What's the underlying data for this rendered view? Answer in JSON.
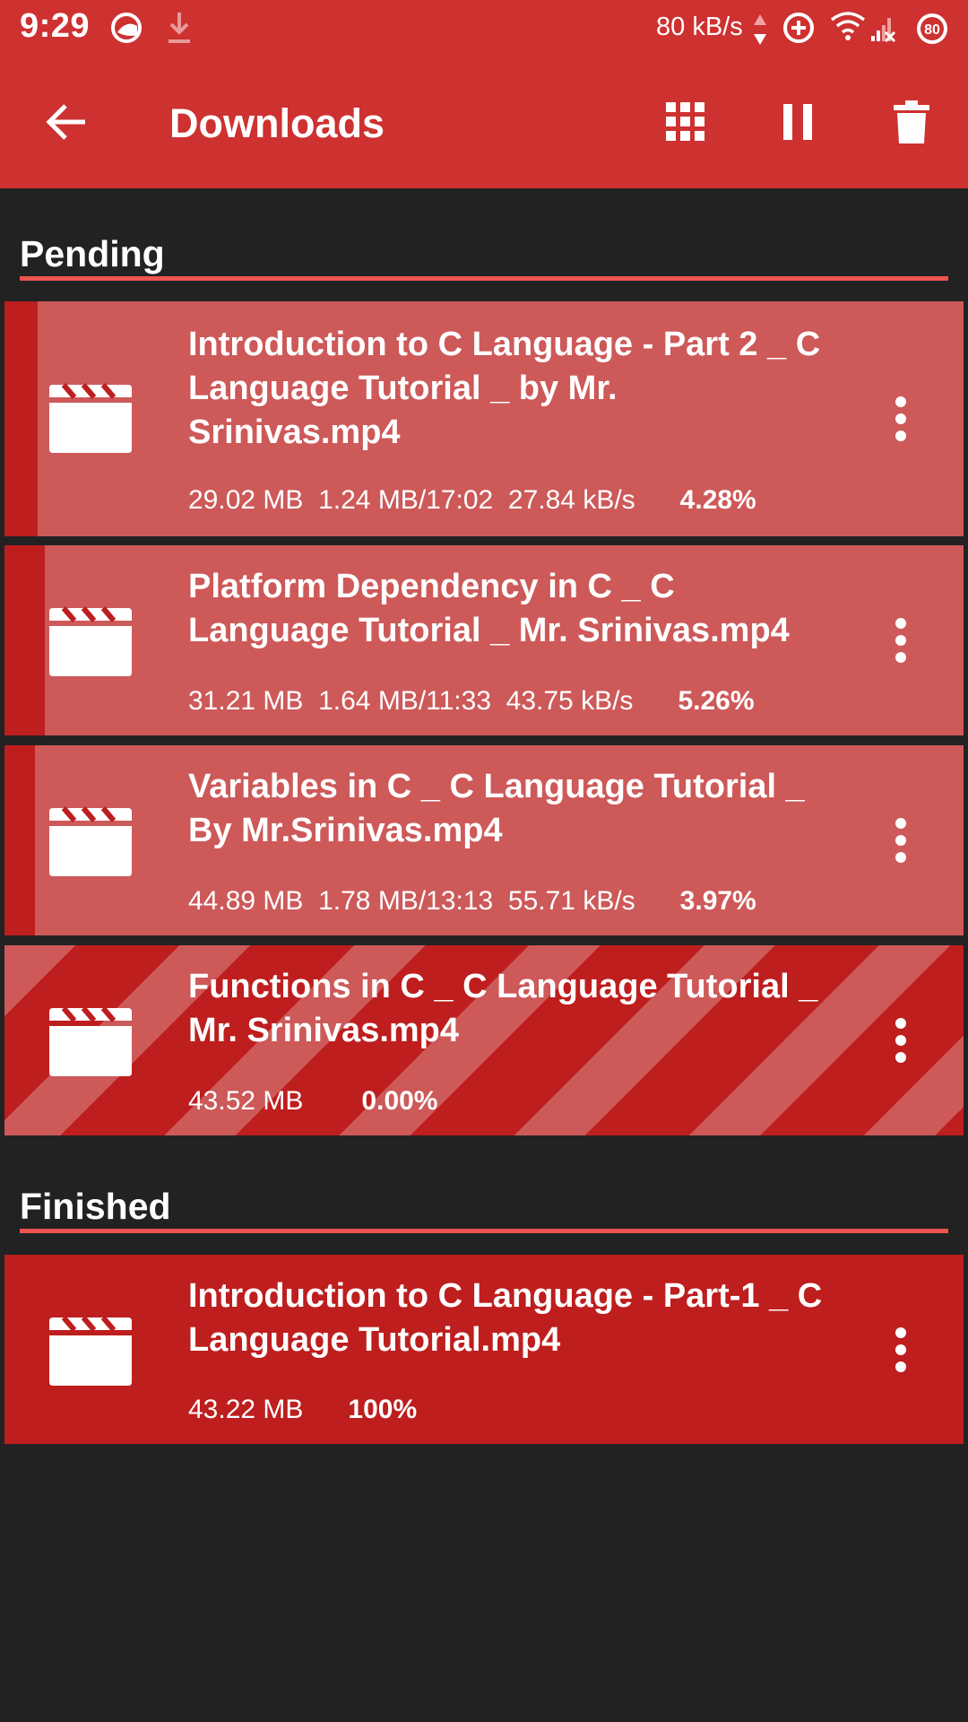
{
  "status_bar": {
    "time": "9:29",
    "net_speed": "80 kB/s",
    "battery": "80"
  },
  "app_bar": {
    "title": "Downloads"
  },
  "colors": {
    "primary": "#cd3130",
    "background": "#222222",
    "card_remaining": "#be1e1e",
    "card_progress": "#cd5959",
    "divider": "#ef5350"
  },
  "sections": {
    "pending": {
      "label": "Pending"
    },
    "finished": {
      "label": "Finished"
    }
  },
  "downloads": [
    {
      "name": "Introduction to C Language - Part 2 _ C Language Tutorial  _  by Mr. Srinivas.mp4",
      "size": "29.02 MB",
      "downloaded": "1.24 MB/17:02",
      "speed": "27.84 kB/s",
      "percent": "4.28%",
      "progress": 0.0428,
      "icon": "movie-clapperboard-icon"
    },
    {
      "name": "Platform Dependency in C _ C Language Tutorial _ Mr. Srinivas.mp4",
      "size": "31.21 MB",
      "downloaded": "1.64 MB/11:33",
      "speed": "43.75 kB/s",
      "percent": "5.26%",
      "progress": 0.0526,
      "icon": "movie-clapperboard-icon"
    },
    {
      "name": "Variables in C _ C Language Tutorial _ By Mr.Srinivas.mp4",
      "size": "44.89 MB",
      "downloaded": "1.78 MB/13:13",
      "speed": "55.71 kB/s",
      "percent": "3.97%",
      "progress": 0.0397,
      "icon": "movie-clapperboard-icon"
    },
    {
      "name": "Functions in C _ C Language Tutorial _ Mr. Srinivas.mp4",
      "size": "43.52 MB",
      "percent": "0.00%",
      "progress": 0,
      "state": "queued",
      "icon": "movie-clapperboard-icon"
    }
  ],
  "finished": [
    {
      "name": "Introduction to C Language - Part-1 _ C Language Tutorial.mp4",
      "size": "43.22 MB",
      "percent": "100%",
      "progress": 1,
      "icon": "movie-clapperboard-icon"
    }
  ]
}
